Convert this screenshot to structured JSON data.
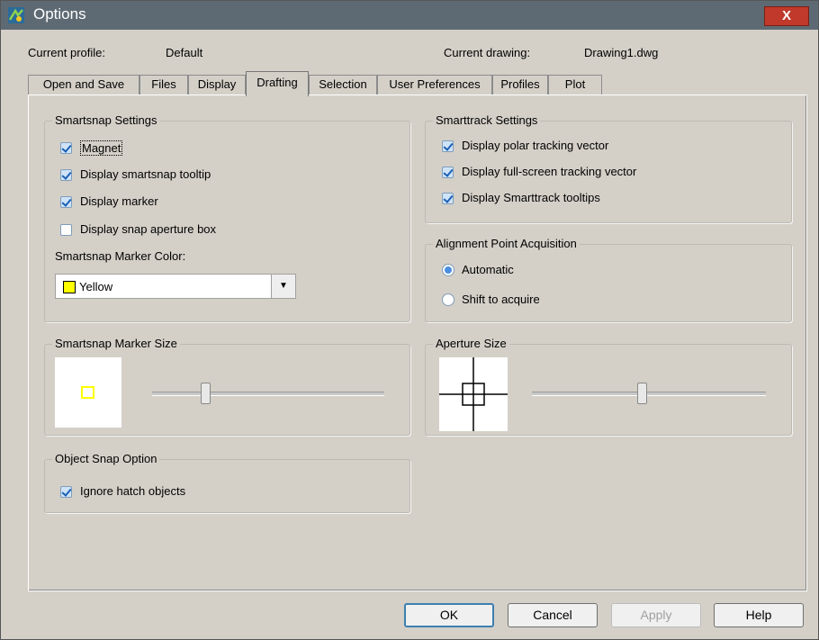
{
  "window": {
    "title": "Options",
    "close_label": "X"
  },
  "profile": {
    "label": "Current profile:",
    "value": "Default"
  },
  "drawing": {
    "label": "Current drawing:",
    "value": "Drawing1.dwg"
  },
  "tabs": [
    {
      "label": "Open and Save"
    },
    {
      "label": "Files"
    },
    {
      "label": "Display"
    },
    {
      "label": "Drafting",
      "active": true
    },
    {
      "label": "Selection"
    },
    {
      "label": "User Preferences"
    },
    {
      "label": "Profiles"
    },
    {
      "label": "Plot"
    }
  ],
  "smartsnap": {
    "title": "Smartsnap Settings",
    "magnet": {
      "label": "Magnet",
      "checked": true
    },
    "tooltip": {
      "label": "Display smartsnap tooltip",
      "checked": true
    },
    "marker": {
      "label": "Display marker",
      "checked": true
    },
    "aperture_box": {
      "label": "Display snap aperture box",
      "checked": false
    },
    "color_label": "Smartsnap Marker Color:",
    "color_value": "Yellow",
    "color_hex": "#ffff00"
  },
  "smarttrack": {
    "title": "Smarttrack Settings",
    "polar": {
      "label": "Display polar tracking vector",
      "checked": true
    },
    "fullscreen": {
      "label": "Display full-screen tracking vector",
      "checked": true
    },
    "tooltips": {
      "label": "Display Smarttrack tooltips",
      "checked": true
    }
  },
  "alignment": {
    "title": "Alignment Point Acquisition",
    "automatic": {
      "label": "Automatic",
      "selected": true
    },
    "shift": {
      "label": "Shift to acquire",
      "selected": false
    }
  },
  "marker_size": {
    "title": "Smartsnap Marker Size",
    "slider_fraction": 0.23
  },
  "aperture_size": {
    "title": "Aperture Size",
    "slider_fraction": 0.47
  },
  "object_snap": {
    "title": "Object Snap Option",
    "ignore_hatch": {
      "label": "Ignore hatch objects",
      "checked": true
    }
  },
  "buttons": {
    "ok": "OK",
    "cancel": "Cancel",
    "apply": "Apply",
    "help": "Help"
  }
}
